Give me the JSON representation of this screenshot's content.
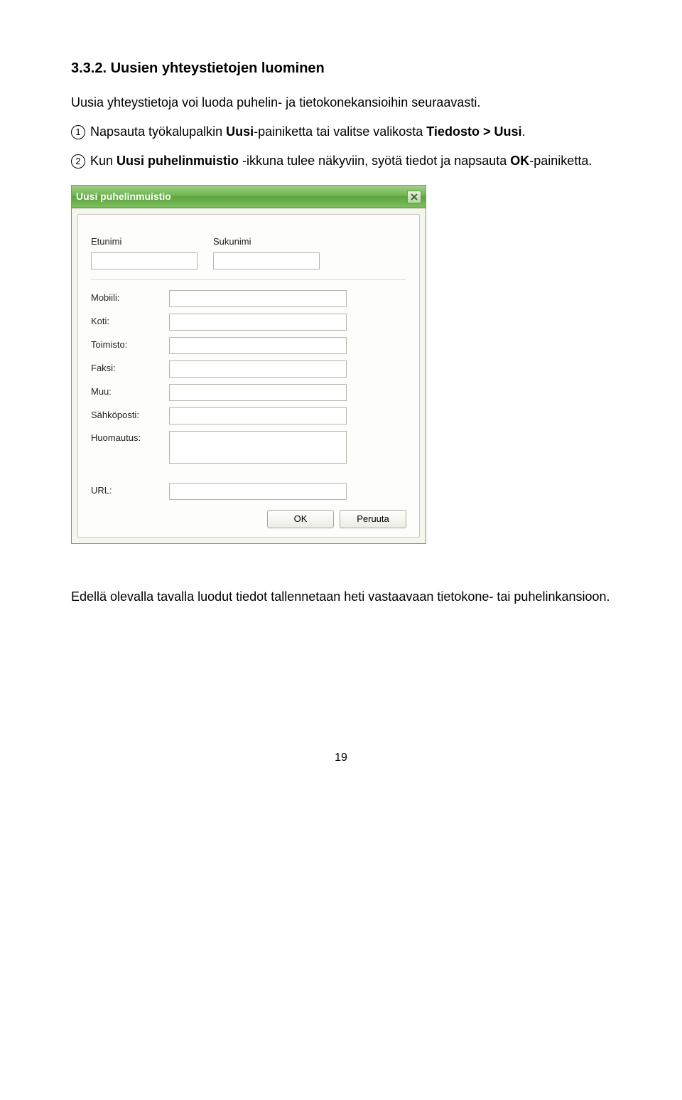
{
  "heading": "3.3.2. Uusien yhteystietojen luominen",
  "intro": "Uusia yhteystietoja voi luoda puhelin- ja tietokonekansioihin seuraavasti.",
  "step1": {
    "num": "1",
    "t0": " Napsauta työkalupalkin ",
    "b1": "Uusi",
    "t1": "-painiketta tai valitse valikosta ",
    "b2": "Tiedosto > Uusi",
    "t2": "."
  },
  "step2": {
    "num": "2",
    "t0": " Kun ",
    "b1": "Uusi puhelinmuistio",
    "t1": " -ikkuna tulee näkyviin, syötä tiedot ja napsauta ",
    "b2": "OK",
    "t2": "-painiketta."
  },
  "dialog": {
    "title": "Uusi puhelinmuistio",
    "labels": {
      "firstname": "Etunimi",
      "lastname": "Sukunimi",
      "mobile": "Mobiili:",
      "home": "Koti:",
      "office": "Toimisto:",
      "fax": "Faksi:",
      "other": "Muu:",
      "email": "Sähköposti:",
      "note": "Huomautus:",
      "url": "URL:"
    },
    "buttons": {
      "ok": "OK",
      "cancel": "Peruuta"
    }
  },
  "outro": "Edellä olevalla tavalla luodut tiedot tallennetaan heti vastaavaan tietokone- tai puhelinkansioon.",
  "page": "19"
}
